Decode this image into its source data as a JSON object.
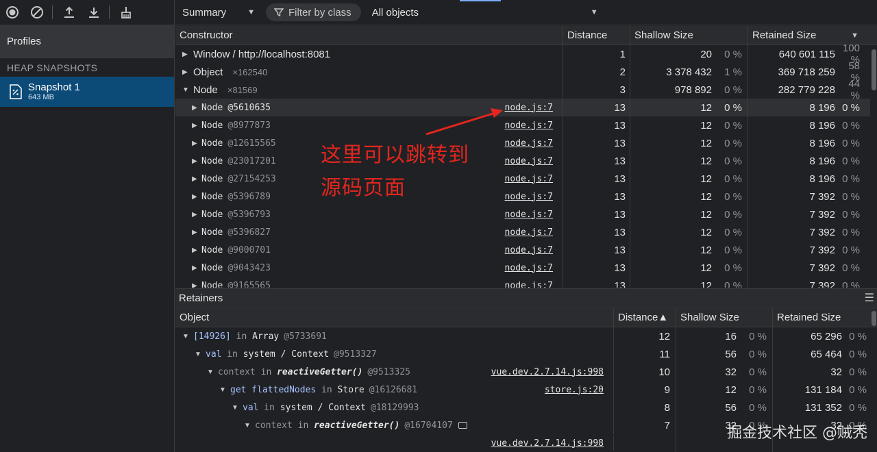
{
  "toolbar": {
    "icons": [
      "record-icon",
      "clear-icon",
      "upload-icon",
      "download-icon",
      "garbage-collect-icon"
    ]
  },
  "sidebar": {
    "profiles_label": "Profiles",
    "section_label": "HEAP SNAPSHOTS",
    "snapshot": {
      "name": "Snapshot 1",
      "size": "643 MB"
    }
  },
  "view_toolbar": {
    "view_select": "Summary",
    "filter_placeholder": "Filter by class",
    "objects_select": "All objects"
  },
  "constructors": {
    "headers": [
      "Constructor",
      "Distance",
      "Shallow Size",
      "Retained Size"
    ],
    "rows": [
      {
        "name": "Window / http://localhost:8081",
        "count": "",
        "expanded": false,
        "distance": "1",
        "shallow": "20",
        "shallow_pct": "0 %",
        "retained": "640 601 115",
        "retained_pct": "100 %"
      },
      {
        "name": "Object",
        "count": "×162540",
        "expanded": false,
        "distance": "2",
        "shallow": "3 378 432",
        "shallow_pct": "1 %",
        "retained": "369 718 259",
        "retained_pct": "58 %"
      },
      {
        "name": "Node",
        "count": "×81569",
        "expanded": true,
        "distance": "3",
        "shallow": "978 892",
        "shallow_pct": "0 %",
        "retained": "282 779 228",
        "retained_pct": "44 %"
      }
    ],
    "children": [
      {
        "label": "Node",
        "id": "@5610635",
        "link": "node.js:7",
        "distance": "13",
        "shallow": "12",
        "shallow_pct": "0 %",
        "retained": "8 196",
        "retained_pct": "0 %"
      },
      {
        "label": "Node",
        "id": "@8977873",
        "link": "node.js:7",
        "distance": "13",
        "shallow": "12",
        "shallow_pct": "0 %",
        "retained": "8 196",
        "retained_pct": "0 %"
      },
      {
        "label": "Node",
        "id": "@12615565",
        "link": "node.js:7",
        "distance": "13",
        "shallow": "12",
        "shallow_pct": "0 %",
        "retained": "8 196",
        "retained_pct": "0 %"
      },
      {
        "label": "Node",
        "id": "@23017201",
        "link": "node.js:7",
        "distance": "13",
        "shallow": "12",
        "shallow_pct": "0 %",
        "retained": "8 196",
        "retained_pct": "0 %"
      },
      {
        "label": "Node",
        "id": "@27154253",
        "link": "node.js:7",
        "distance": "13",
        "shallow": "12",
        "shallow_pct": "0 %",
        "retained": "8 196",
        "retained_pct": "0 %"
      },
      {
        "label": "Node",
        "id": "@5396789",
        "link": "node.js:7",
        "distance": "13",
        "shallow": "12",
        "shallow_pct": "0 %",
        "retained": "7 392",
        "retained_pct": "0 %"
      },
      {
        "label": "Node",
        "id": "@5396793",
        "link": "node.js:7",
        "distance": "13",
        "shallow": "12",
        "shallow_pct": "0 %",
        "retained": "7 392",
        "retained_pct": "0 %"
      },
      {
        "label": "Node",
        "id": "@5396827",
        "link": "node.js:7",
        "distance": "13",
        "shallow": "12",
        "shallow_pct": "0 %",
        "retained": "7 392",
        "retained_pct": "0 %"
      },
      {
        "label": "Node",
        "id": "@9000701",
        "link": "node.js:7",
        "distance": "13",
        "shallow": "12",
        "shallow_pct": "0 %",
        "retained": "7 392",
        "retained_pct": "0 %"
      },
      {
        "label": "Node",
        "id": "@9043423",
        "link": "node.js:7",
        "distance": "13",
        "shallow": "12",
        "shallow_pct": "0 %",
        "retained": "7 392",
        "retained_pct": "0 %"
      },
      {
        "label": "Node",
        "id": "@9165565",
        "link": "node.js:7",
        "distance": "13",
        "shallow": "12",
        "shallow_pct": "0 %",
        "retained": "7 392",
        "retained_pct": "0 %"
      }
    ]
  },
  "retainers": {
    "title": "Retainers",
    "headers": [
      "Object",
      "Distance▲",
      "Shallow Size",
      "Retained Size"
    ],
    "rows": [
      {
        "prefix": "[14926]",
        "prefix_style": "prop",
        "mid": " in ",
        "obj": "Array",
        "id": "@5733691",
        "link": "",
        "distance": "12",
        "shallow": "16",
        "shallow_pct": "0 %",
        "retained": "65 296",
        "retained_pct": "0 %"
      },
      {
        "prefix": "val",
        "prefix_style": "prop",
        "mid": " in ",
        "obj": "system / Context",
        "id": "@9513327",
        "link": "",
        "distance": "11",
        "shallow": "56",
        "shallow_pct": "0 %",
        "retained": "65 464",
        "retained_pct": "0 %"
      },
      {
        "prefix": "context",
        "prefix_style": "ctx",
        "mid": " in ",
        "obj": "reactiveGetter()",
        "id": "@9513325",
        "link": "vue.dev.2.7.14.js:998",
        "distance": "10",
        "shallow": "32",
        "shallow_pct": "0 %",
        "retained": "32",
        "retained_pct": "0 %"
      },
      {
        "prefix": "get flattedNodes",
        "prefix_style": "prop",
        "mid": " in ",
        "obj": "Store",
        "id": "@16126681",
        "link": "store.js:20",
        "distance": "9",
        "shallow": "12",
        "shallow_pct": "0 %",
        "retained": "131 184",
        "retained_pct": "0 %"
      },
      {
        "prefix": "val",
        "prefix_style": "prop",
        "mid": " in ",
        "obj": "system / Context",
        "id": "@18129993",
        "link": "",
        "distance": "8",
        "shallow": "56",
        "shallow_pct": "0 %",
        "retained": "131 352",
        "retained_pct": "0 %"
      },
      {
        "prefix": "context",
        "prefix_style": "ctx",
        "mid": " in ",
        "obj": "reactiveGetter()",
        "id": "@16704107",
        "link": "",
        "distance": "7",
        "shallow": "32",
        "shallow_pct": "0 %",
        "retained": "32",
        "retained_pct": "0 %"
      }
    ],
    "trailing_link": "vue.dev.2.7.14.js:998"
  },
  "annotation": {
    "line1": "这里可以跳转到",
    "line2": "源码页面",
    "color": "#e3261e"
  },
  "watermark": "掘金技术社区 @贼秃"
}
